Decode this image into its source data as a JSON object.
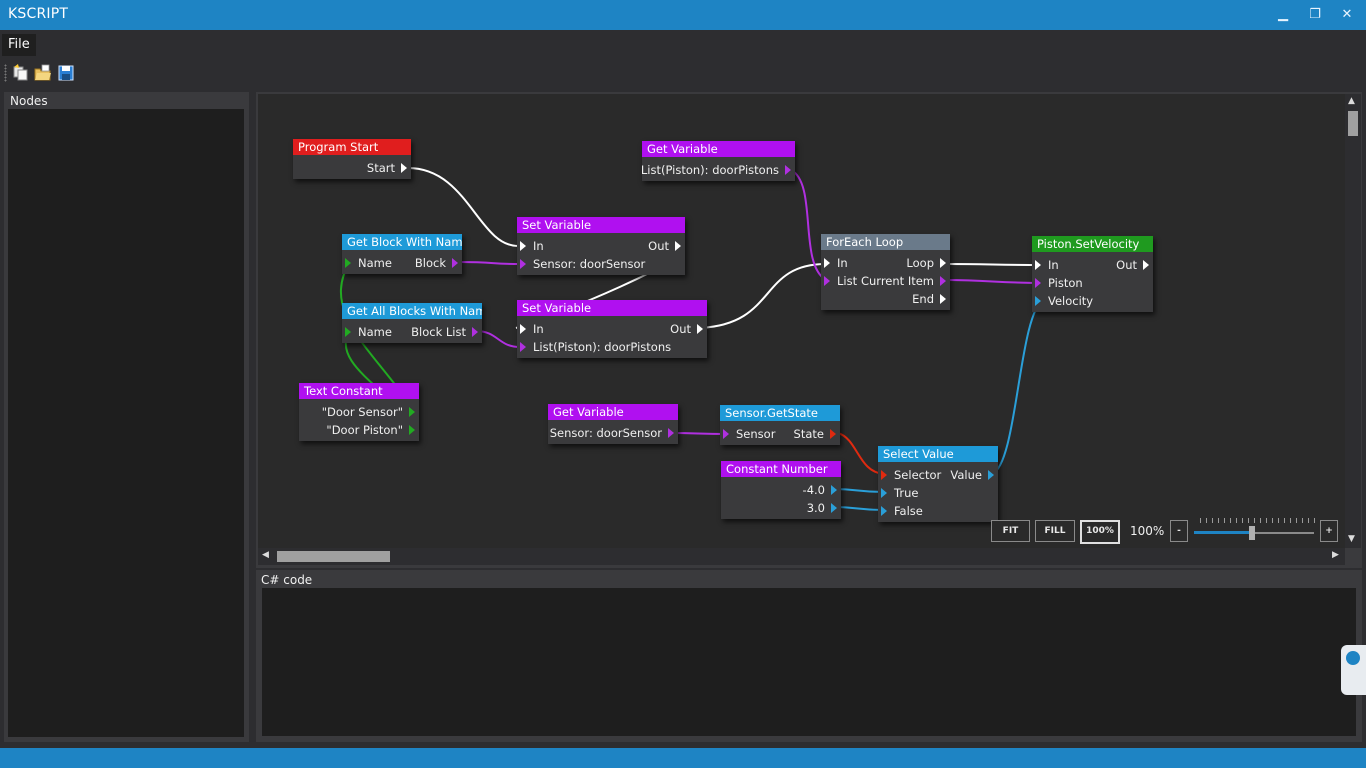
{
  "window": {
    "title": "KSCRIPT",
    "minimize": "▁",
    "restore": "❐",
    "close": "✕"
  },
  "menu": {
    "file": "File"
  },
  "toolbar": {
    "icons": [
      "new-node-icon",
      "open-folder-icon",
      "save-icon"
    ]
  },
  "panels": {
    "nodes_header": "Nodes",
    "code_header": "C# code",
    "code_text": ""
  },
  "colors": {
    "accent": "#1e84c4",
    "event": "#e01e1e",
    "variable": "#b010f0",
    "block": "#1e9ad8",
    "loop": "#6a7a8a",
    "piston": "#1f9a1f",
    "wire_exec": "#ffffff",
    "wire_purple": "#b030e0",
    "wire_green": "#22aa22",
    "wire_blue": "#2a9fd8",
    "wire_red": "#e02a10"
  },
  "nodes": {
    "program_start": {
      "title": "Program Start",
      "start": "Start"
    },
    "get_block": {
      "title": "Get Block With Name",
      "name": "Name",
      "block": "Block"
    },
    "get_all_blocks": {
      "title": "Get All Blocks With Name",
      "name": "Name",
      "block_list": "Block List"
    },
    "text_constant": {
      "title": "Text Constant",
      "value1": "\"Door Sensor\"",
      "value2": "\"Door Piston\""
    },
    "set_var1": {
      "title": "Set Variable",
      "in": "In",
      "out": "Out",
      "sensor": "Sensor: doorSensor"
    },
    "set_var2": {
      "title": "Set Variable",
      "in": "In",
      "out": "Out",
      "list": "List(Piston): doorPistons"
    },
    "get_var1": {
      "title": "Get Variable",
      "list": "List(Piston): doorPistons"
    },
    "foreach": {
      "title": "ForEach Loop",
      "in": "In",
      "loop": "Loop",
      "list": "List",
      "current": "Current Item",
      "end": "End"
    },
    "piston": {
      "title": "Piston.SetVelocity",
      "in": "In",
      "out": "Out",
      "piston": "Piston",
      "velocity": "Velocity"
    },
    "get_var2": {
      "title": "Get Variable",
      "sensor": "Sensor: doorSensor"
    },
    "sensor_state": {
      "title": "Sensor.GetState",
      "sensor": "Sensor",
      "state": "State"
    },
    "constant_number": {
      "title": "Constant Number",
      "v1": "-4.0",
      "v2": "3.0"
    },
    "select_value": {
      "title": "Select Value",
      "selector": "Selector",
      "value": "Value",
      "true": "True",
      "false": "False"
    }
  },
  "zoom": {
    "fit": "FIT",
    "fill": "FILL",
    "hundred": "100%",
    "level": "100%",
    "minus": "-",
    "plus": "+",
    "slider_fraction": 0.5
  }
}
